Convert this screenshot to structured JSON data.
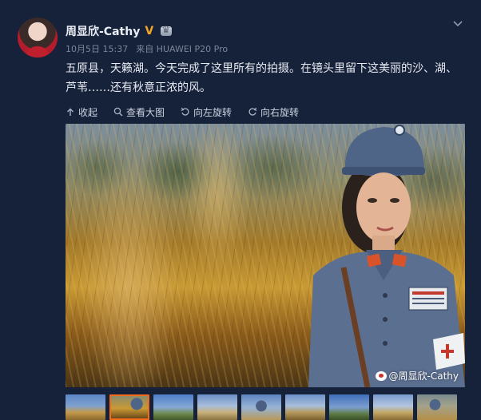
{
  "post": {
    "author": "周显欣-Cathy",
    "date": "10月5日 15:37",
    "source_prefix": "来自",
    "source": "HUAWEI P20 Pro",
    "text": "五原县，天籁湖。今天完成了这里所有的拍摄。在镜头里留下这美丽的沙、湖、芦苇……还有秋意正浓的风。"
  },
  "toolbar": {
    "collapse_label": "收起",
    "view_large_label": "查看大图",
    "rotate_left_label": "向左旋转",
    "rotate_right_label": "向右旋转"
  },
  "photo": {
    "watermark": "@周显欣-Cathy"
  },
  "thumbnails": {
    "count": 9,
    "selected_index": 1
  },
  "colors": {
    "background": "#16213a",
    "verified_badge": "#f5a623",
    "selected_thumb_border": "#f26b1d",
    "text": "#e6ebf2",
    "meta": "#7c879a"
  },
  "icons": {
    "verified": "verified-v-icon",
    "member": "crown-icon",
    "menu": "chevron-down-icon",
    "collapse": "arrow-up-icon",
    "view_large": "magnifier-icon",
    "rotate_left": "rotate-left-icon",
    "rotate_right": "rotate-right-icon",
    "watermark": "weibo-logo-icon"
  }
}
